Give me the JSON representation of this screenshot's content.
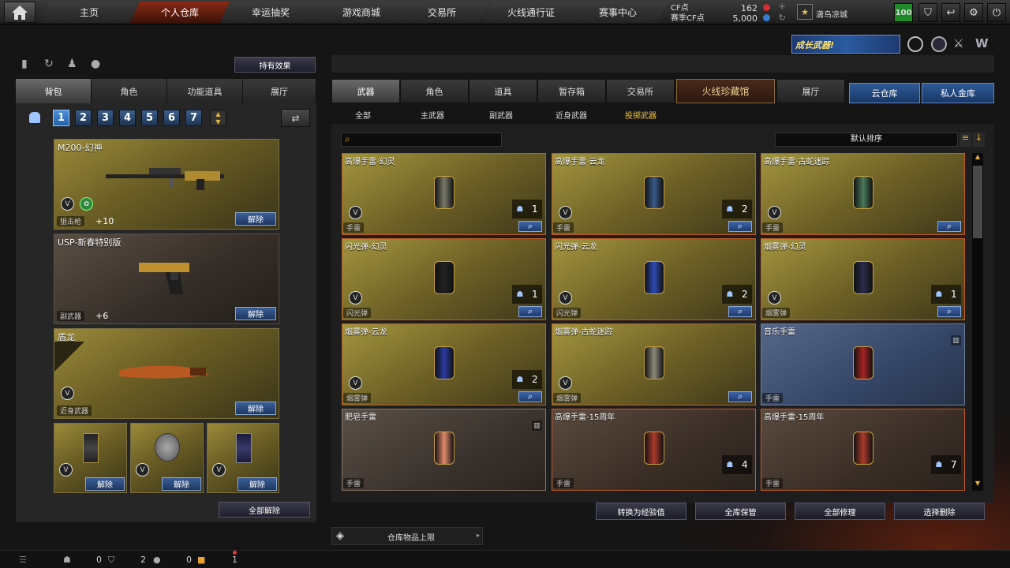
{
  "nav": [
    "主页",
    "个人仓库",
    "幸运抽奖",
    "游戏商城",
    "交易所",
    "火线通行证",
    "赛事中心"
  ],
  "currency": {
    "cf_label": "CF点",
    "cf_value": "162",
    "event_label": "赛季CF点",
    "event_value": "5,000"
  },
  "user": {
    "name": "潇鸟凉城",
    "level": "100"
  },
  "banner_text": "成长武器!",
  "left": {
    "effects_button": "持有效果",
    "tabs": [
      "背包",
      "角色",
      "功能道具",
      "展厅"
    ],
    "pages": [
      "1",
      "2",
      "3",
      "4",
      "5",
      "6",
      "7"
    ],
    "slots": [
      {
        "name": "M200-幻神",
        "category": "狙击枪",
        "level": "+10",
        "action": "解除"
      },
      {
        "name": "USP-新春特别版",
        "category": "副武器",
        "level": "+6",
        "action": "解除"
      },
      {
        "name": "盾龙",
        "category": "近身武器",
        "action": "解除"
      }
    ],
    "small_slots": [
      {
        "action": "解除"
      },
      {
        "action": "解除"
      },
      {
        "action": "解除"
      }
    ],
    "unequip_all": "全部解除"
  },
  "right": {
    "tabs": [
      "武器",
      "角色",
      "道具",
      "暂存箱",
      "交易所",
      "火线珍藏馆",
      "展厅"
    ],
    "tabs2": [
      "云仓库",
      "私人金库"
    ],
    "subtabs": [
      "全部",
      "主武器",
      "副武器",
      "近身武器",
      "投掷武器"
    ],
    "sort_label": "默认排序",
    "items": [
      {
        "name": "高爆手雷-幻灵",
        "cat": "手雷",
        "count": "1",
        "style": "gold",
        "color": "#7a7a6a"
      },
      {
        "name": "高爆手雷-云龙",
        "cat": "手雷",
        "count": "2",
        "style": "gold",
        "color": "#3a5a8a"
      },
      {
        "name": "高爆手雷-古蛇迷踪",
        "cat": "手雷",
        "count": "",
        "style": "gold",
        "color": "#4a7a5a"
      },
      {
        "name": "闪光弹-幻灵",
        "cat": "闪光弹",
        "count": "1",
        "style": "gold",
        "color": "#222222"
      },
      {
        "name": "闪光弹-云龙",
        "cat": "闪光弹",
        "count": "2",
        "style": "gold",
        "color": "#2a4ab0"
      },
      {
        "name": "烟雾弹-幻灵",
        "cat": "烟雾弹",
        "count": "1",
        "style": "gold",
        "color": "#2a2a4a"
      },
      {
        "name": "烟雾弹-云龙",
        "cat": "烟雾弹",
        "count": "2",
        "style": "gold",
        "color": "#2a3aa0"
      },
      {
        "name": "烟雾弹-古蛇迷踪",
        "cat": "烟雾弹",
        "count": "",
        "style": "gold",
        "color": "#8a8a7a"
      },
      {
        "name": "音乐手雷",
        "cat": "手雷",
        "count": "",
        "style": "blue",
        "color": "#aa2222"
      },
      {
        "name": "肥皂手雷",
        "cat": "手雷",
        "count": "",
        "style": "brown",
        "color": "#e08a6a"
      },
      {
        "name": "高爆手雷-15周年",
        "cat": "手雷",
        "count": "4",
        "style": "dark",
        "color": "#aa3a2a"
      },
      {
        "name": "高爆手雷-15周年",
        "cat": "手雷",
        "count": "7",
        "style": "dark",
        "color": "#aa3a2a"
      }
    ],
    "actions": [
      "转换为经验值",
      "全库保管",
      "全部修理",
      "选择删除"
    ],
    "limit_label": "仓库物品上限"
  },
  "status": {
    "c1": "0",
    "c2": "2",
    "c3": "0",
    "c4": "1"
  }
}
